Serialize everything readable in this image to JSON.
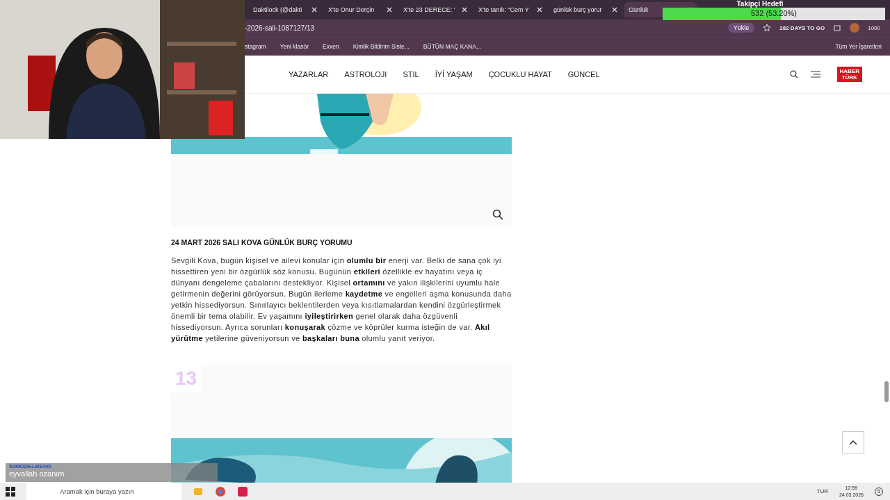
{
  "browser": {
    "tabs": [
      {
        "label": "Daktilock (@dakti",
        "selected": false
      },
      {
        "label": "X'te Onur Derçin",
        "selected": false
      },
      {
        "label": "X'te 23 DERECE: '",
        "selected": false
      },
      {
        "label": "X'te tanık: \"Cem Y",
        "selected": false
      },
      {
        "label": "günlük burç yorur",
        "selected": false
      },
      {
        "label": "Günlük",
        "selected": true
      }
    ],
    "address": "-2026-sali-1087127/13",
    "upload_button": "Yükle",
    "extension_text": "282 DAYS TO GO",
    "profile_count": "1000",
    "bookmarks": [
      "stagram",
      "Yeni klasör",
      "Exxen",
      "Kimlik Bildirim Siste...",
      "BÜTÜN MAÇ KANA..."
    ],
    "all_bookmarks": "Tüm Yer İşaretleri"
  },
  "follower_goal": {
    "title": "Takipçi Hedefi",
    "reading": "532 (53.20%)",
    "level": 0.532
  },
  "site": {
    "nav": [
      "YAZARLAR",
      "ASTROLOJI",
      "STIL",
      "İYİ YAŞAM",
      "ÇOCUKLU HAYAT",
      "GÜNCEL"
    ],
    "logo": [
      "HABER",
      "TÜRK"
    ]
  },
  "article": {
    "heading": "24 MART 2026 SALI KOVA GÜNLÜK BURÇ YORUMU",
    "body": "Sevgili Kova, bugün kişisel ve ailevi konular için **olumlu bir** enerji var. Belki de sana çok iyi hissettiren yeni bir özgürlük söz konusu. Bugünün **etkileri** özellikle ev hayatını veya iç dünyanı dengeleme çabalarını destekliyor. Kişisel **ortamını** ve yakın ilişkilerini uyumlu hale getirmenin değerini görüyorsun. Bugün ilerleme **kaydetme** ve engelleri aşma konusunda daha yetkin hissediyorsun. Sınırlayıcı beklentilerden veya kısıtlamalardan kendini özgürleştirmek önemli bir tema olabilir. Ev yaşamını **iyileştirirken** genel olarak daha özgüvenli hissediyorsun. Ayrıca sorunları **konuşarak** çözme ve köprüler kurma isteğin de var. **Akıl yürütme** yetilerine güveniyorsun ve **başkaları buna** olumlu yanıt veriyor.",
    "next_number": "13"
  },
  "chat": {
    "user": "92MODELRENO",
    "message": "eyvallah ozanım"
  },
  "taskbar": {
    "search_placeholder": "Aramak için buraya yazın",
    "language": "TUR",
    "time": "12:59",
    "date": "24.03.2026",
    "notifications": "5"
  }
}
